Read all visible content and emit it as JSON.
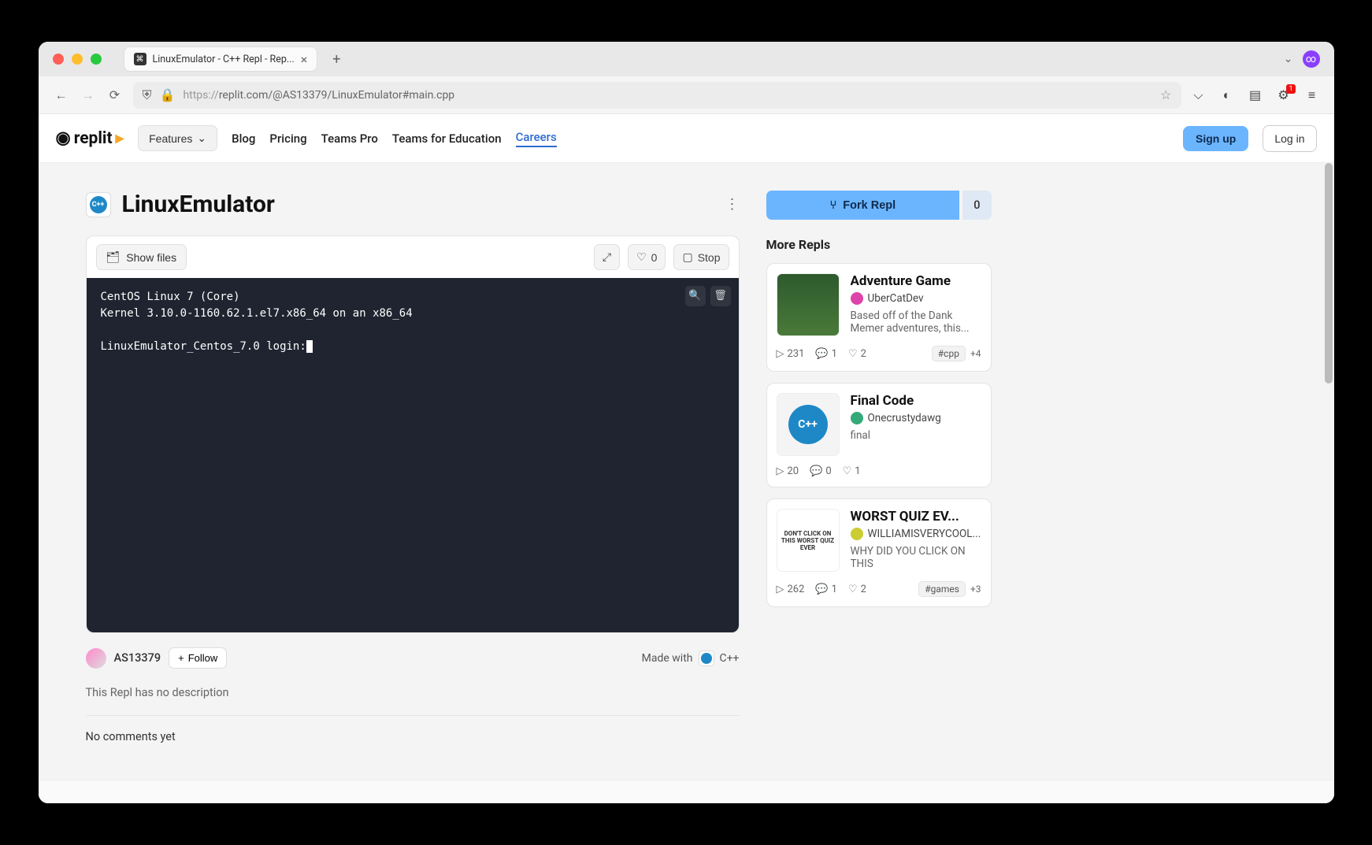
{
  "browser": {
    "tab_title": "LinuxEmulator - C++ Repl - Rep...",
    "url_proto": "https://",
    "url_rest": "replit.com/@AS13379/LinuxEmulator#main.cpp",
    "toolbar_badge": "1"
  },
  "nav": {
    "features": "Features",
    "links": [
      "Blog",
      "Pricing",
      "Teams Pro",
      "Teams for Education",
      "Careers"
    ],
    "signup": "Sign up",
    "login": "Log in"
  },
  "repl": {
    "title": "LinuxEmulator",
    "show_files": "Show files",
    "like_count": "0",
    "stop": "Stop",
    "terminal_line1": "CentOS Linux 7 (Core)",
    "terminal_line2": "Kernel 3.10.0-1160.62.1.el7.x86_64 on an x86_64",
    "terminal_line3": "LinuxEmulator_Centos_7.0 login:",
    "author": "AS13379",
    "follow": "Follow",
    "made_with_label": "Made with",
    "made_with_lang": "C++",
    "description": "This Repl has no description",
    "comments": "No comments yet"
  },
  "sidebar": {
    "fork": "Fork Repl",
    "fork_count": "0",
    "more_repls": "More Repls",
    "cards": [
      {
        "title": "Adventure Game",
        "author": "UberCatDev",
        "desc": "Based off of the Dank Memer adventures, this...",
        "runs": "231",
        "comments": "1",
        "likes": "2",
        "tag": "#cpp",
        "tag_more": "+4"
      },
      {
        "title": "Final Code",
        "author": "Onecrustydawg",
        "desc": "final",
        "runs": "20",
        "comments": "0",
        "likes": "1",
        "tag": "",
        "tag_more": ""
      },
      {
        "title": "WORST QUIZ EV...",
        "author": "WILLIAMISVERYCOOL...",
        "desc": "WHY DID YOU CLICK ON THIS",
        "thumb_text": "DON'T CLICK ON THIS WORST QUIZ EVER",
        "runs": "262",
        "comments": "1",
        "likes": "2",
        "tag": "#games",
        "tag_more": "+3"
      }
    ]
  }
}
